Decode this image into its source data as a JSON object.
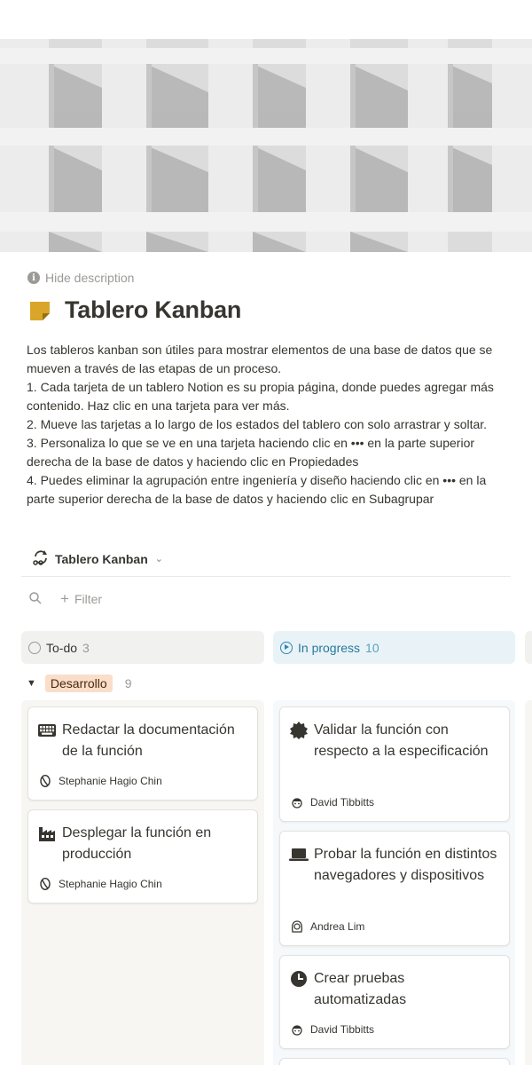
{
  "page": {
    "hide_description": "Hide description",
    "title": "Tablero Kanban",
    "description": [
      "Los tableros kanban son útiles para mostrar elementos de una base de datos que se mueven a través de las etapas de un proceso.",
      "1. Cada tarjeta de un tablero Notion es su propia página, donde puedes agregar más contenido. Haz clic en una tarjeta para ver más.",
      "2. Mueve las tarjetas a lo largo de los estados del tablero con solo arrastrar y soltar.",
      "3. Personaliza lo que se ve en una tarjeta haciendo clic en ••• en la parte superior derecha de la base de datos y haciendo clic en Propiedades",
      "4. Puedes eliminar la agrupación entre ingeniería y diseño haciendo clic en ••• en la parte superior derecha de la base de datos y haciendo clic en Subagrupar"
    ]
  },
  "view": {
    "name": "Tablero Kanban",
    "icon": "board-view-icon"
  },
  "toolbar": {
    "search_icon": "search-icon",
    "filter_label": "Filter"
  },
  "columns": [
    {
      "label": "To-do",
      "count": "3",
      "icon": "circle-status-icon"
    },
    {
      "label": "In progress",
      "count": "10",
      "icon": "play-status-icon"
    }
  ],
  "group": {
    "label": "Desarrollo",
    "count": "9"
  },
  "cards": {
    "todo": [
      {
        "title": "Redactar la documentación de la función",
        "icon": "keyboard-icon",
        "person": "Stephanie Hagio Chin"
      },
      {
        "title": "Desplegar la función en producción",
        "icon": "factory-icon",
        "person": "Stephanie Hagio Chin"
      }
    ],
    "progress": [
      {
        "title": "Validar la función con respecto a la especificación",
        "icon": "gear-badge-icon",
        "person": "David Tibbitts"
      },
      {
        "title": "Probar la función en distintos navegadores y dispositivos",
        "icon": "laptop-icon",
        "person": "Andrea Lim"
      },
      {
        "title": "Crear pruebas automatizadas",
        "icon": "clock-icon",
        "person": "David Tibbitts"
      }
    ]
  },
  "colors": {
    "accent_blue": "#28789c",
    "group_tag_bg": "#fadec9",
    "muted": "#9b9a97"
  }
}
